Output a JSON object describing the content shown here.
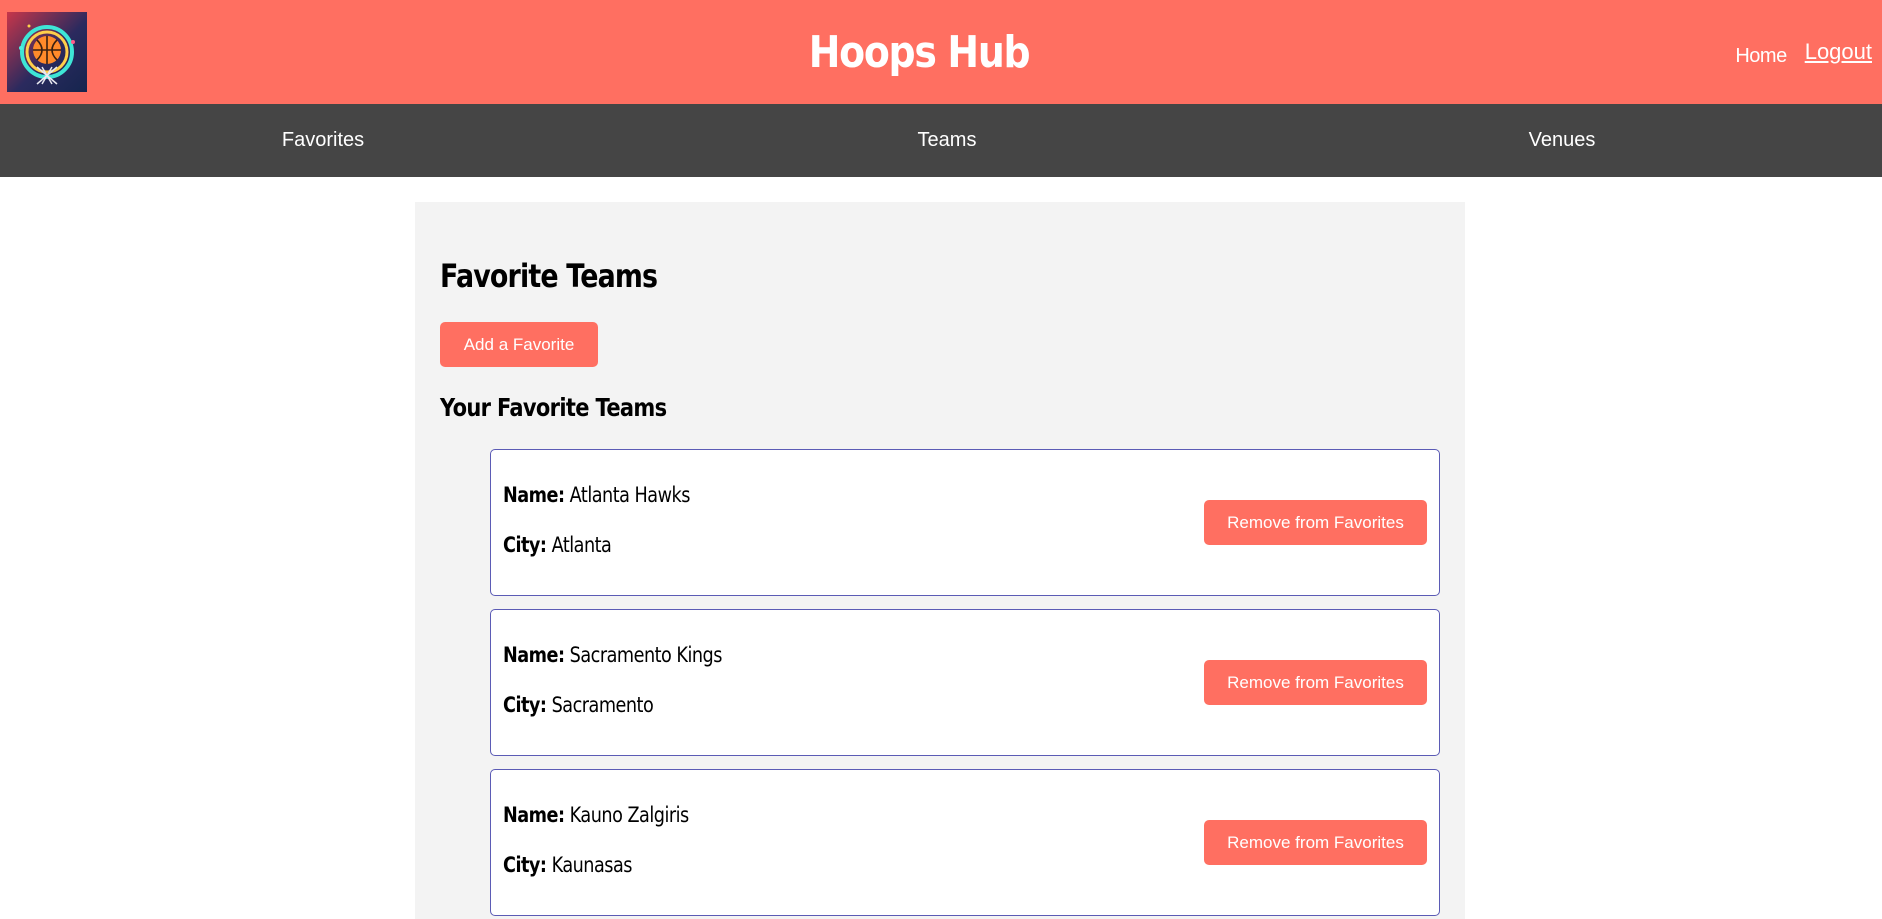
{
  "header": {
    "logo_icon": "basketball-logo-icon",
    "title": "Hoops Hub",
    "home_label": "Home",
    "logout_label": "Logout",
    "background_color": "#ff6f61"
  },
  "nav": {
    "background_color": "#454545",
    "items": [
      {
        "label": "Favorites"
      },
      {
        "label": "Teams"
      },
      {
        "label": "Venues"
      }
    ]
  },
  "main": {
    "title": "Favorite Teams",
    "add_button_label": "Add a Favorite",
    "list_title": "Your Favorite Teams",
    "name_label": "Name:",
    "city_label": "City:",
    "remove_button_label": "Remove from Favorites",
    "accent_color": "#ff6f61",
    "favorites": [
      {
        "name": "Atlanta Hawks",
        "city": "Atlanta"
      },
      {
        "name": "Sacramento Kings",
        "city": "Sacramento"
      },
      {
        "name": "Kauno Zalgiris",
        "city": "Kaunasas"
      }
    ]
  }
}
